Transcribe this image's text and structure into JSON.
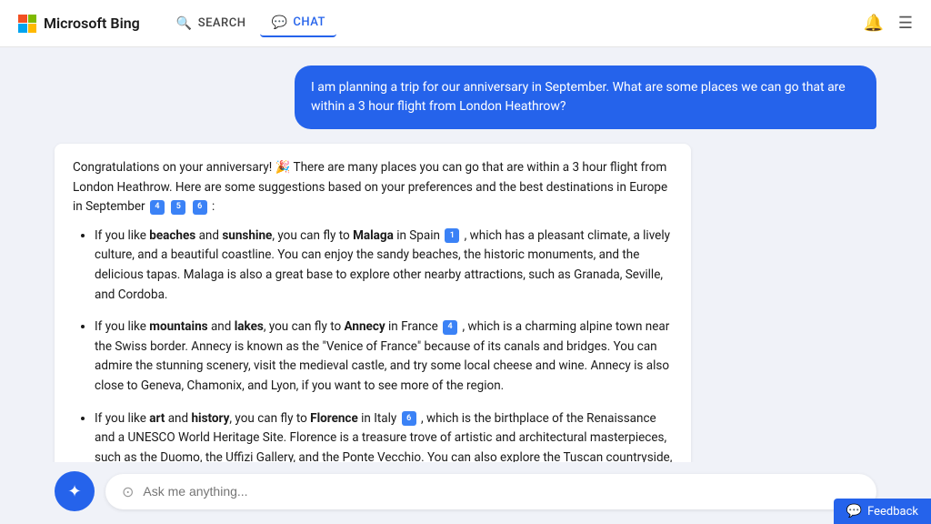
{
  "header": {
    "logo_text": "Microsoft Bing",
    "nav": [
      {
        "id": "search",
        "label": "SEARCH",
        "active": false
      },
      {
        "id": "chat",
        "label": "CHAT",
        "active": true
      }
    ]
  },
  "chat": {
    "user_message": "I am planning a trip for our anniversary in September. What are some places we can go that are within a 3 hour flight from London Heathrow?",
    "bot_intro": "Congratulations on your anniversary! 🎉 There are many places you can go that are within a 3 hour flight from London Heathrow. Here are some suggestions based on your preferences and the best destinations in Europe in September",
    "bot_citations_intro": [
      "4",
      "5",
      "6"
    ],
    "bot_items": [
      {
        "if_like": "beaches",
        "and": "sunshine",
        "connector": "you can fly to",
        "destination": "Malaga",
        "country": "in Spain",
        "citation": "1",
        "description": ", which has a pleasant climate, a lively culture, and a beautiful coastline. You can enjoy the sandy beaches, the historic monuments, and the delicious tapas. Malaga is also a great base to explore other nearby attractions, such as Granada, Seville, and Cordoba."
      },
      {
        "if_like": "mountains",
        "and": "lakes",
        "connector": "you can fly to",
        "destination": "Annecy",
        "country": "in France",
        "citation": "4",
        "description": ", which is a charming alpine town near the Swiss border. Annecy is known as the \"Venice of France\" because of its canals and bridges. You can admire the stunning scenery, visit the medieval castle, and try some local cheese and wine. Annecy is also close to Geneva, Chamonix, and Lyon, if you want to see more of the region."
      },
      {
        "if_like": "art",
        "and": "history",
        "connector": "you can fly to",
        "destination": "Florence",
        "country": "in Italy",
        "citation": "6",
        "description": ", which is the birthplace of the Renaissance and a UNESCO World Heritage Site. Florence is a treasure trove of artistic and architectural masterpieces, such as the Duomo, the Uffizi Gallery, and the Ponte Vecchio. You can also explore the Tuscan countryside, taste the famous gelato, and shop for leather goods."
      }
    ]
  },
  "input": {
    "placeholder": "Ask me anything..."
  },
  "feedback": {
    "label": "Feedback"
  }
}
